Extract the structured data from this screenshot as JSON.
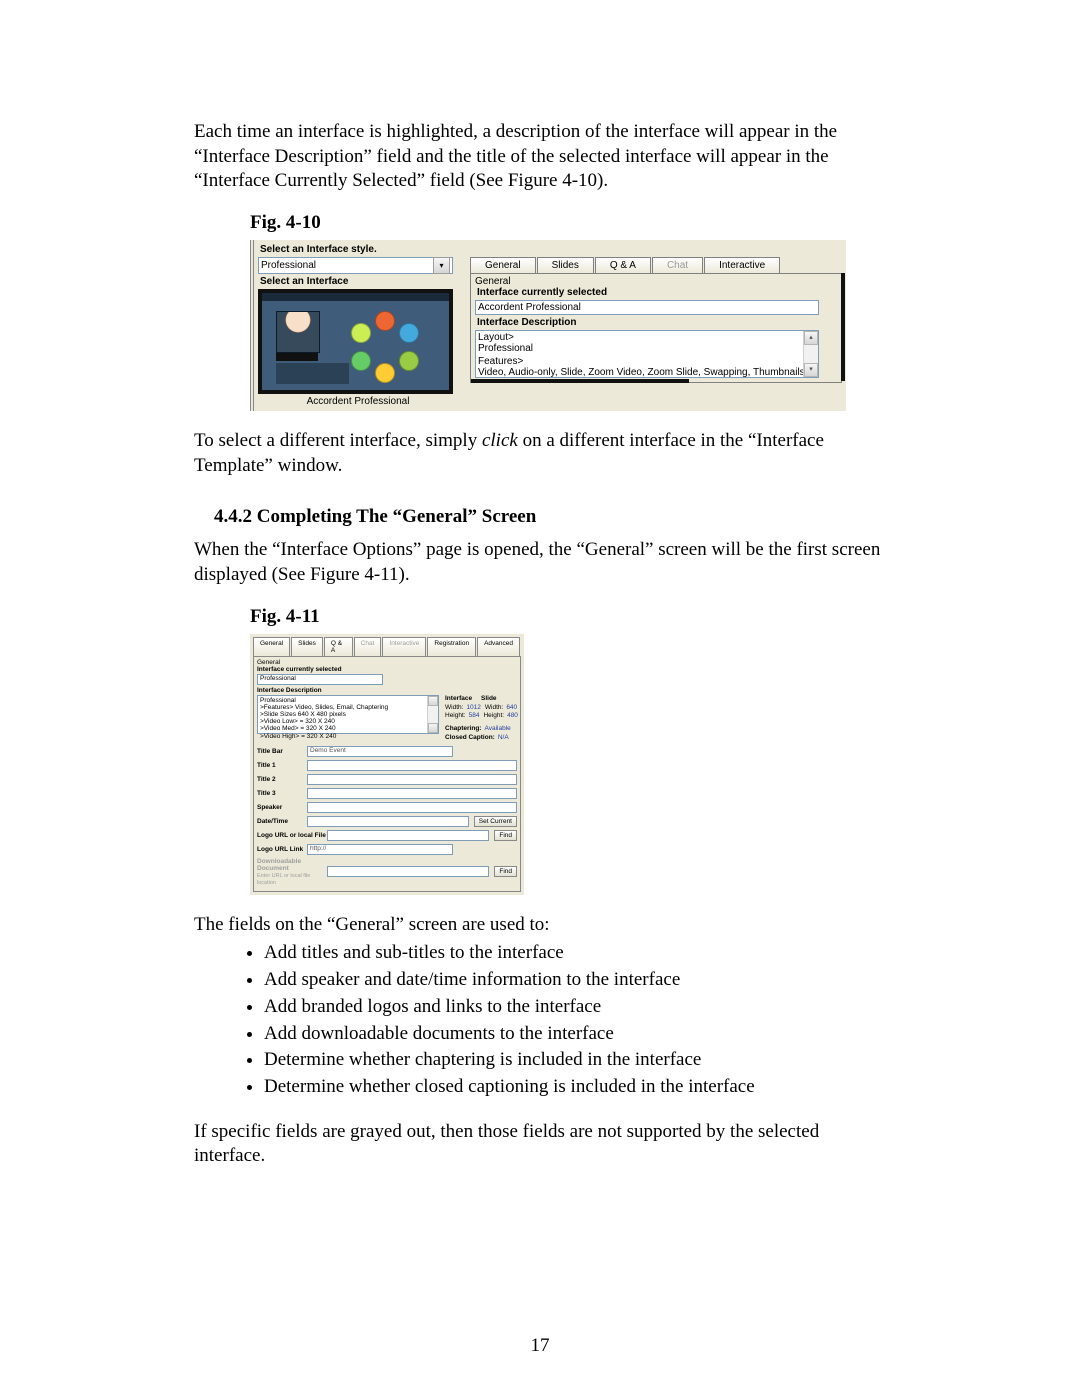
{
  "para1": "Each time an interface is highlighted, a description of the interface will appear in the “Interface Description” field and the title of the selected interface will appear in the “Interface Currently Selected” field (See Figure 4-10).",
  "fig410_caption": "Fig. 4-10",
  "fig410": {
    "select_style": "Select an Interface style.",
    "style_value": "Professional",
    "select_interface": "Select an Interface",
    "template_caption": "Accordent Professional",
    "tabs": [
      "General",
      "Slides",
      "Q & A",
      "Chat",
      "Interactive"
    ],
    "group_lbl": "General",
    "ics_lbl": "Interface currently selected",
    "ics_val": "Accordent Professional",
    "desc_lbl": "Interface Description",
    "desc_l1": "Layout>",
    "desc_l2": "Professional",
    "desc_l3": "Features>",
    "desc_l4": "Video, Audio-only, Slide, Zoom Video, Zoom Slide, Swapping, Thumbnails, Chapters, Closed Captions, Email, Resource Files, Resource Links, Moderated"
  },
  "para2a": "To select a different interface, simply ",
  "para2b": "click",
  "para2c": " on a different interface in the “Interface Template” window.",
  "h3": "4.4.2  Completing The “General” Screen",
  "para3": "When the “Interface Options” page is opened, the “General” screen will be the first screen displayed (See Figure 4-11).",
  "fig411_caption": "Fig. 4-11",
  "fig411": {
    "tabs": [
      "General",
      "Slides",
      "Q & A",
      "Chat",
      "Interactive",
      "Registration",
      "Advanced"
    ],
    "group_lbl": "General",
    "ics_lbl": "Interface currently selected",
    "ics_val": "Professional",
    "desc_lbl": "Interface Description",
    "desc_lines": [
      "Professional",
      ">Features> Video, Slides, Email, Chaptering",
      ">Slide Sizes 640 X 480 pixels",
      ">Video Low> = 320 X 240",
      ">Video Med> = 320 X 240",
      ">Video High> = 320 X 240"
    ],
    "meta_interface_lbl": "Interface",
    "meta_slide_lbl": "Slide",
    "meta_width_lbl": "Width:",
    "meta_height_lbl": "Height:",
    "iface_w": "1012",
    "iface_h": "584",
    "slide_w": "640",
    "slide_h": "480",
    "chaptering_lbl": "Chaptering:",
    "chaptering_val": "Available",
    "cc_lbl": "Closed Caption:",
    "cc_val": "N/A",
    "form_labels": {
      "title_bar": "Title Bar",
      "title_bar_val": "Demo Event",
      "t1": "Title 1",
      "t2": "Title 2",
      "t3": "Title 3",
      "speaker": "Speaker",
      "datetime": "Date/Time",
      "set_current": "Set Current",
      "logo_url": "Logo URL or local File",
      "logo_link_lbl": "Logo URL Link",
      "logo_link_val": "http://",
      "find": "Find",
      "dl_doc": "Downloadable Document",
      "dl_doc_hint": "Enter URL or local file location"
    }
  },
  "para4": "The fields on the “General” screen are used to:",
  "bullets": [
    "Add titles and sub-titles to the interface",
    "Add speaker and date/time information to the interface",
    "Add branded logos and links to the interface",
    "Add downloadable documents to the interface",
    "Determine whether chaptering is included in the interface",
    "Determine whether closed captioning is included in the interface"
  ],
  "para5": "If specific fields are grayed out, then those fields are not supported by the selected interface.",
  "page_num": "17"
}
